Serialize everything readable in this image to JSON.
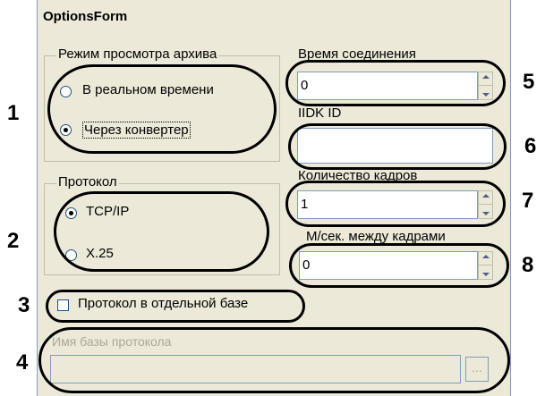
{
  "window": {
    "title": "OptionsForm"
  },
  "archive_mode": {
    "label": "Режим просмотра архива",
    "options": [
      "В реальном времени",
      "Через конвертер"
    ],
    "selected": "Через конвертер"
  },
  "protocol": {
    "label": "Протокол",
    "options": [
      "TCP/IP",
      "X.25"
    ],
    "selected": "TCP/IP"
  },
  "separate_db": {
    "label": "Протокол в отдельной базе",
    "checked": false
  },
  "db_name": {
    "label": "Имя базы протокола",
    "value": "",
    "browse_label": "..."
  },
  "connection_time": {
    "label": "Время соединения",
    "value": "0"
  },
  "iidk_id": {
    "label": "IIDK ID",
    "value": ""
  },
  "frame_count": {
    "label": "Количество кадров",
    "value": "1"
  },
  "ms_between": {
    "label": "М/сек. между кадрами",
    "value": "0"
  },
  "callouts": [
    "1",
    "2",
    "3",
    "4",
    "5",
    "6",
    "7",
    "8"
  ]
}
